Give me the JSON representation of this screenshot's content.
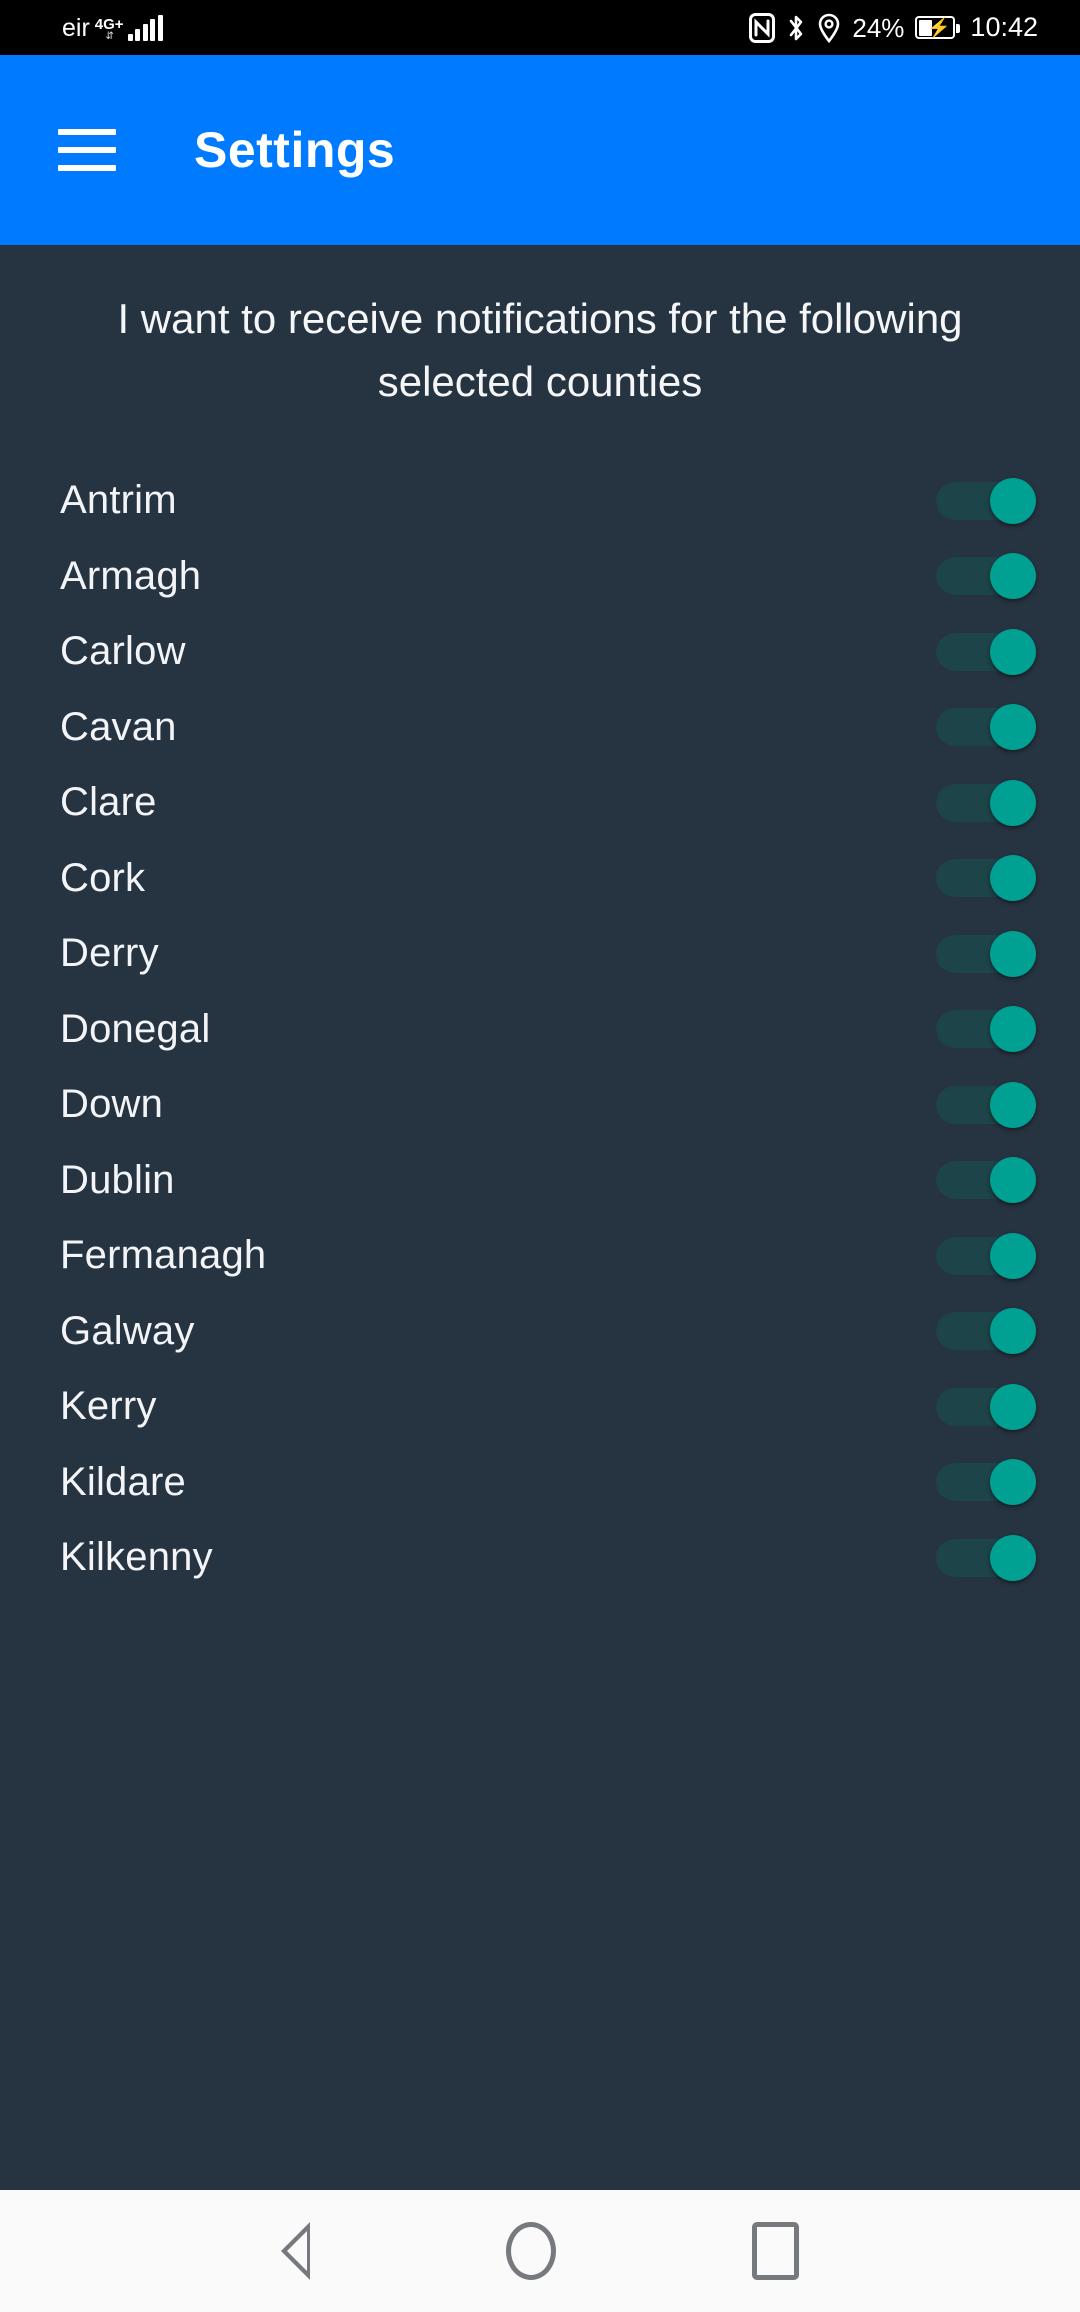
{
  "status_bar": {
    "carrier": "eir",
    "network_type": "4G+",
    "icons": [
      "nfc-icon",
      "bluetooth-icon",
      "location-icon"
    ],
    "battery_percent": "24%",
    "battery_state": "charging",
    "time": "10:42"
  },
  "app_bar": {
    "menu_icon": "hamburger-menu-icon",
    "title": "Settings",
    "background_color": "#007bff"
  },
  "content": {
    "lead_text": "I want to receive notifications for the following selected counties",
    "background_color": "#263340",
    "switch_on_color": "#00a093",
    "switch_track_color": "#1d4448",
    "counties": [
      {
        "name": "Antrim",
        "enabled": true
      },
      {
        "name": "Armagh",
        "enabled": true
      },
      {
        "name": "Carlow",
        "enabled": true
      },
      {
        "name": "Cavan",
        "enabled": true
      },
      {
        "name": "Clare",
        "enabled": true
      },
      {
        "name": "Cork",
        "enabled": true
      },
      {
        "name": "Derry",
        "enabled": true
      },
      {
        "name": "Donegal",
        "enabled": true
      },
      {
        "name": "Down",
        "enabled": true
      },
      {
        "name": "Dublin",
        "enabled": true
      },
      {
        "name": "Fermanagh",
        "enabled": true
      },
      {
        "name": "Galway",
        "enabled": true
      },
      {
        "name": "Kerry",
        "enabled": true
      },
      {
        "name": "Kildare",
        "enabled": true
      },
      {
        "name": "Kilkenny",
        "enabled": true
      }
    ]
  },
  "navigation_bar": {
    "back": "back-triangle-icon",
    "home": "home-circle-icon",
    "recents": "recents-square-icon"
  }
}
